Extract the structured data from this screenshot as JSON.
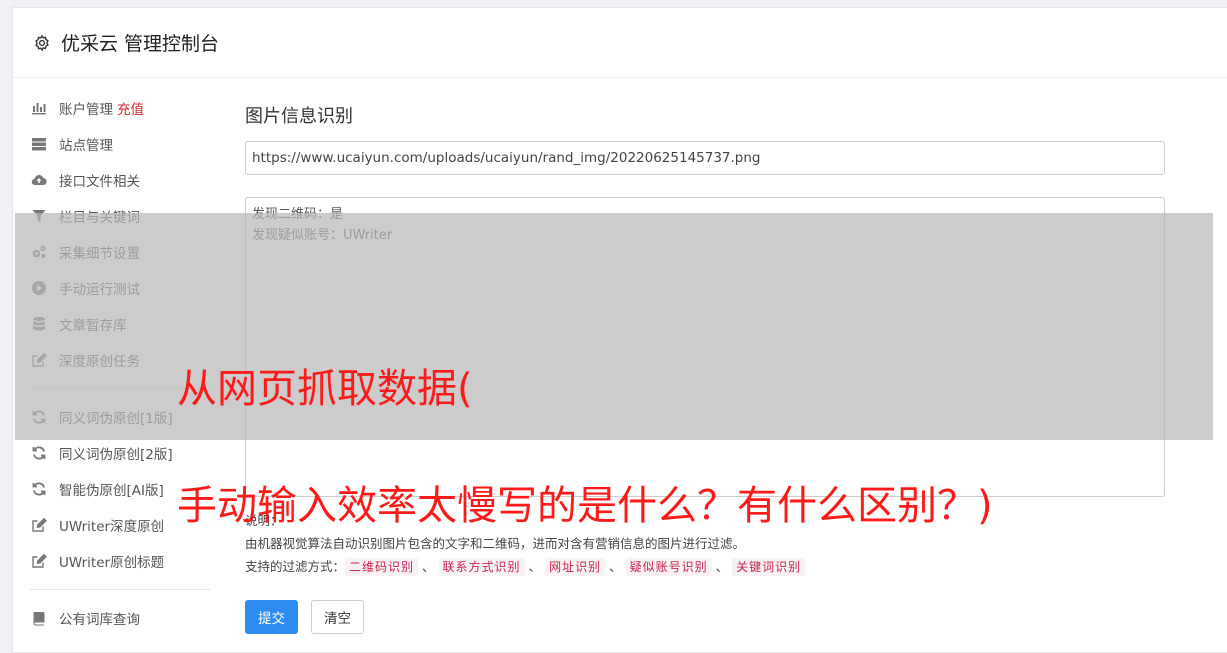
{
  "header": {
    "title": "优采云 管理控制台",
    "icon": "gear-icon"
  },
  "sidebar": {
    "group1": [
      {
        "label": "账户管理",
        "extra": "充值",
        "icon": "bar-chart-icon"
      },
      {
        "label": "站点管理",
        "icon": "server-icon"
      },
      {
        "label": "接口文件相关",
        "icon": "cloud-upload-icon"
      },
      {
        "label": "栏目与关键词",
        "icon": "filter-icon"
      },
      {
        "label": "采集细节设置",
        "icon": "gears-icon"
      },
      {
        "label": "手动运行测试",
        "icon": "play-circle-icon"
      },
      {
        "label": "文章暂存库",
        "icon": "database-icon"
      },
      {
        "label": "深度原创任务",
        "icon": "edit-icon"
      }
    ],
    "group2": [
      {
        "label": "同义词伪原创[1版]",
        "icon": "refresh-icon"
      },
      {
        "label": "同义词伪原创[2版]",
        "icon": "refresh-icon"
      },
      {
        "label": "智能伪原创[AI版]",
        "icon": "refresh-icon"
      },
      {
        "label": "UWriter深度原创",
        "icon": "edit-icon"
      },
      {
        "label": "UWriter原创标题",
        "icon": "edit-icon"
      }
    ],
    "group3": [
      {
        "label": "公有词库查询",
        "icon": "book-icon"
      }
    ]
  },
  "main": {
    "section_title": "图片信息识别",
    "url_value": "https://www.ucaiyun.com/uploads/ucaiyun/rand_img/20220625145737.png",
    "result_lines": [
      "发现二维码：是",
      "发现疑似账号：UWriter"
    ],
    "notes_label": "说明：",
    "notes_desc": "由机器视觉算法自动识别图片包含的文字和二维码，进而对含有营销信息的图片进行过滤。",
    "filter_label": "支持的过滤方式：",
    "filter_tags": [
      "二维码识别",
      "联系方式识别",
      "网址识别",
      "疑似账号识别",
      "关键词识别"
    ],
    "filter_sep": "、",
    "submit_label": "提交",
    "clear_label": "清空"
  },
  "overlay": {
    "line1": "从网页抓取数据(",
    "line2": "手动输入效率太慢写的是什么？有什么区别？)"
  },
  "colors": {
    "accent": "#2d8cf0",
    "red": "#d7262f",
    "tag_bg": "#f9f2f4",
    "tag_fg": "#c7254e",
    "overlay_text": "#ff1a1a"
  }
}
